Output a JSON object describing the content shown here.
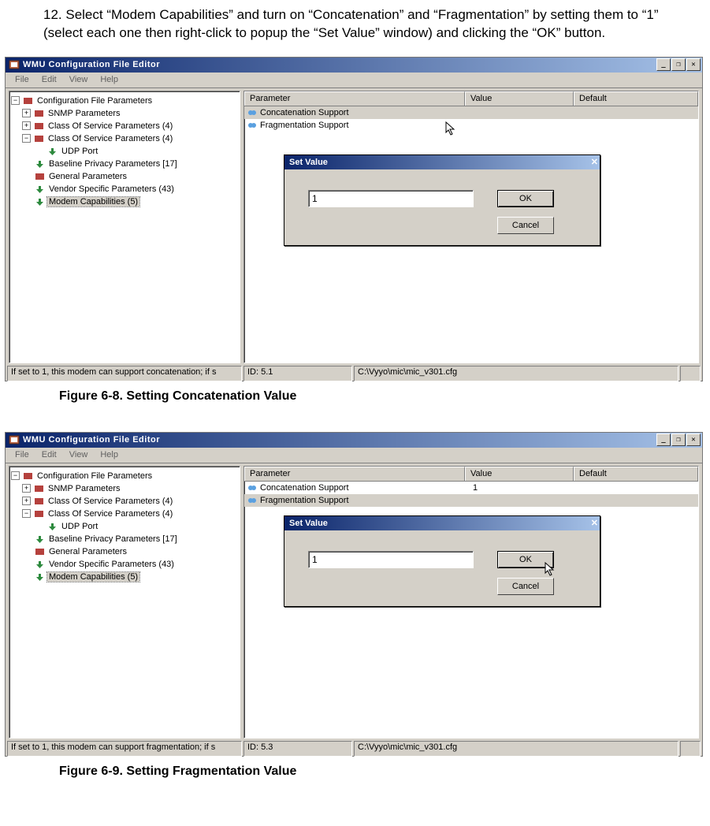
{
  "instruction": "12. Select “Modem Capabilities” and turn on “Concatenation” and “Fragmentation” by setting them to “1” (select each one then right-click to popup the “Set Value” window)  and clicking the “OK” button.",
  "captions": {
    "fig1": "Figure 6-8. Setting Concatenation Value",
    "fig2": "Figure 6-9. Setting Fragmentation Value"
  },
  "app": {
    "title": "WMU Configuration File Editor",
    "menu": [
      "File",
      "Edit",
      "View",
      "Help"
    ]
  },
  "tree": {
    "root": "Configuration File Parameters",
    "items": [
      "SNMP Parameters",
      "Class Of Service Parameters (4)",
      "Class Of Service Parameters (4)",
      "UDP Port",
      "Baseline Privacy Parameters [17]",
      "General Parameters",
      "Vendor Specific Parameters (43)",
      "Modem Capabilities (5)"
    ]
  },
  "params": {
    "headers": {
      "p": "Parameter",
      "v": "Value",
      "d": "Default"
    },
    "rows": [
      {
        "name": "Concatenation Support"
      },
      {
        "name": "Fragmentation Support"
      }
    ]
  },
  "dialog": {
    "title": "Set Value",
    "ok": "OK",
    "cancel": "Cancel",
    "input": "1"
  },
  "status1": {
    "hint": "If set to 1, this modem can support concatenation; if s",
    "id": "ID: 5.1",
    "path": "C:\\Vyyo\\mic\\mic_v301.cfg"
  },
  "status2": {
    "hint": "If set to 1, this modem can support fragmentation; if s",
    "id": "ID: 5.3",
    "path": "C:\\Vyyo\\mic\\mic_v301.cfg"
  },
  "values2": {
    "concat": "1"
  }
}
